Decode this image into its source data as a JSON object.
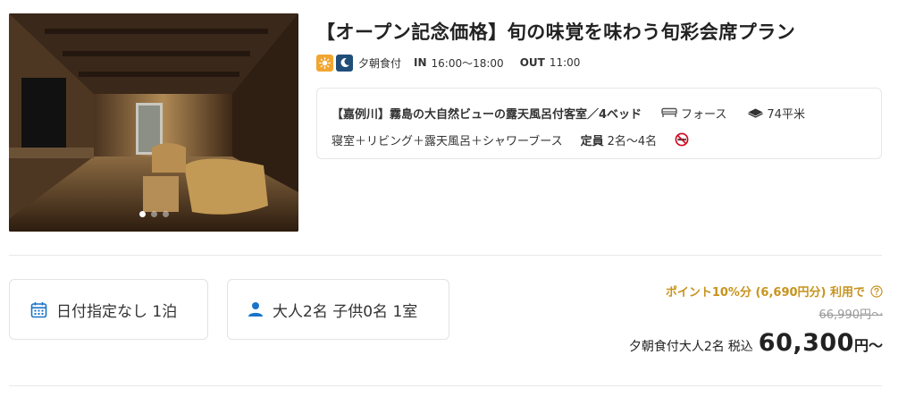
{
  "photo": {
    "slide_count": 3,
    "active_slide": 1
  },
  "plan": {
    "title": "【オープン記念価格】旬の味覚を味わう旬彩会席プラン"
  },
  "meals": {
    "label": "夕朝食付",
    "check_in_label": "IN",
    "check_in_time": "16:00〜18:00",
    "check_out_label": "OUT",
    "check_out_time": "11:00",
    "icons": [
      "sun-icon",
      "moon-icon"
    ]
  },
  "room": {
    "name": "【嘉例川】霧島の大自然ビューの露天風呂付客室／4ベッド",
    "bed": "フォース",
    "area": "74平米",
    "layout": "寝室＋リビング＋露天風呂＋シャワーブース",
    "capacity_label": "定員",
    "capacity_value": "2名〜4名",
    "non_smoking": true
  },
  "selectors": {
    "date_label": "日付指定なし 1泊",
    "guests_label": "大人2名 子供0名 1室"
  },
  "price": {
    "points_text": "ポイント10%分 (6,690円分) 利用で",
    "original_price": "66,990円〜",
    "description": "夕朝食付大人2名",
    "tax_label": "税込",
    "amount": "60,300",
    "unit": "円〜"
  },
  "colors": {
    "accent_gold": "#c7931d",
    "icon_blue": "#1a73c8",
    "sun_orange": "#f1a62f",
    "moon_navy": "#1f4e79",
    "no_smoking_red": "#d0021b"
  }
}
